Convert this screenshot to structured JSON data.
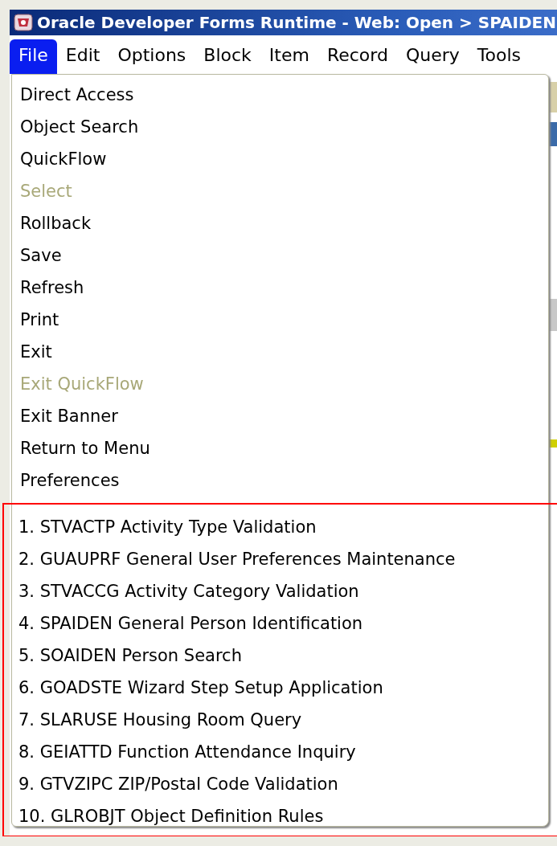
{
  "window": {
    "title": "Oracle Developer Forms Runtime - Web:  Open > SPAIDEN"
  },
  "menu_bar": [
    {
      "label": "File",
      "selected": true
    },
    {
      "label": "Edit",
      "selected": false
    },
    {
      "label": "Options",
      "selected": false
    },
    {
      "label": "Block",
      "selected": false
    },
    {
      "label": "Item",
      "selected": false
    },
    {
      "label": "Record",
      "selected": false
    },
    {
      "label": "Query",
      "selected": false
    },
    {
      "label": "Tools",
      "selected": false
    }
  ],
  "file_menu": {
    "items": [
      {
        "label": "Direct Access",
        "disabled": false
      },
      {
        "label": "Object Search",
        "disabled": false
      },
      {
        "label": "QuickFlow",
        "disabled": false
      },
      {
        "label": "Select",
        "disabled": true
      },
      {
        "label": "Rollback",
        "disabled": false
      },
      {
        "label": "Save",
        "disabled": false
      },
      {
        "label": "Refresh",
        "disabled": false
      },
      {
        "label": "Print",
        "disabled": false
      },
      {
        "label": "Exit",
        "disabled": false
      },
      {
        "label": "Exit QuickFlow",
        "disabled": true
      },
      {
        "label": "Exit Banner",
        "disabled": false
      },
      {
        "label": "Return to Menu",
        "disabled": false
      },
      {
        "label": "Preferences",
        "disabled": false
      }
    ],
    "recent_forms": [
      {
        "label": "1. STVACTP Activity Type Validation"
      },
      {
        "label": "2. GUAUPRF General User Preferences Maintenance"
      },
      {
        "label": "3. STVACCG Activity Category Validation"
      },
      {
        "label": "4. SPAIDEN General Person Identification"
      },
      {
        "label": "5. SOAIDEN Person Search"
      },
      {
        "label": "6. GOADSTE Wizard Step Setup Application"
      },
      {
        "label": "7. SLARUSE Housing Room Query"
      },
      {
        "label": "8. GEIATTD Function Attendance Inquiry"
      },
      {
        "label": "9. GTVZIPC ZIP/Postal Code Validation"
      },
      {
        "label": "10. GLROBJT Object Definition Rules"
      }
    ]
  }
}
